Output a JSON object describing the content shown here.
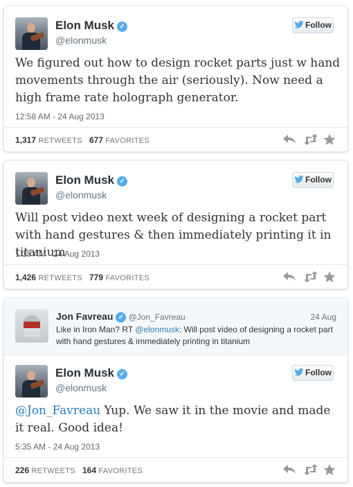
{
  "tweets": [
    {
      "name": "Elon Musk",
      "handle": "@elonmusk",
      "follow_label": "Follow",
      "text": "We figured out how to design rocket parts just w hand movements through the air (seriously). Now need a high frame rate holograph generator.",
      "time": "12:58 AM - 24 Aug 2013",
      "retweets": "1,317",
      "retweets_label": "RETWEETS",
      "favorites": "677",
      "favorites_label": "FAVORITES"
    },
    {
      "name": "Elon Musk",
      "handle": "@elonmusk",
      "follow_label": "Follow",
      "text": "Will post video next week of designing a rocket part with hand gestures & then immediately printing it in titanium",
      "time": "1:15 AM - 24 Aug 2013",
      "retweets": "1,426",
      "retweets_label": "RETWEETS",
      "favorites": "779",
      "favorites_label": "FAVORITES"
    },
    {
      "quoted": {
        "name": "Jon Favreau",
        "handle": "@Jon_Favreau",
        "date": "24 Aug",
        "text_prefix": "Like in Iron Man? RT ",
        "mention": "@elonmusk",
        "text_suffix": ": Will post video of designing a rocket part with hand gestures & immediately printing in titanium"
      },
      "name": "Elon Musk",
      "handle": "@elonmusk",
      "follow_label": "Follow",
      "mention": "@Jon_Favreau",
      "text": " Yup. We saw it in the movie and made it real. Good idea!",
      "time": "5:35 AM - 24 Aug 2013",
      "retweets": "226",
      "retweets_label": "RETWEETS",
      "favorites": "164",
      "favorites_label": "FAVORITES"
    }
  ],
  "icons": {
    "verified": "verified-badge-icon",
    "reply": "reply-icon",
    "retweet": "retweet-icon",
    "favorite": "star-icon",
    "bird": "twitter-bird-icon"
  },
  "colors": {
    "verified": "#55acee",
    "link": "#2b7bb9",
    "action_icon": "#999999"
  }
}
